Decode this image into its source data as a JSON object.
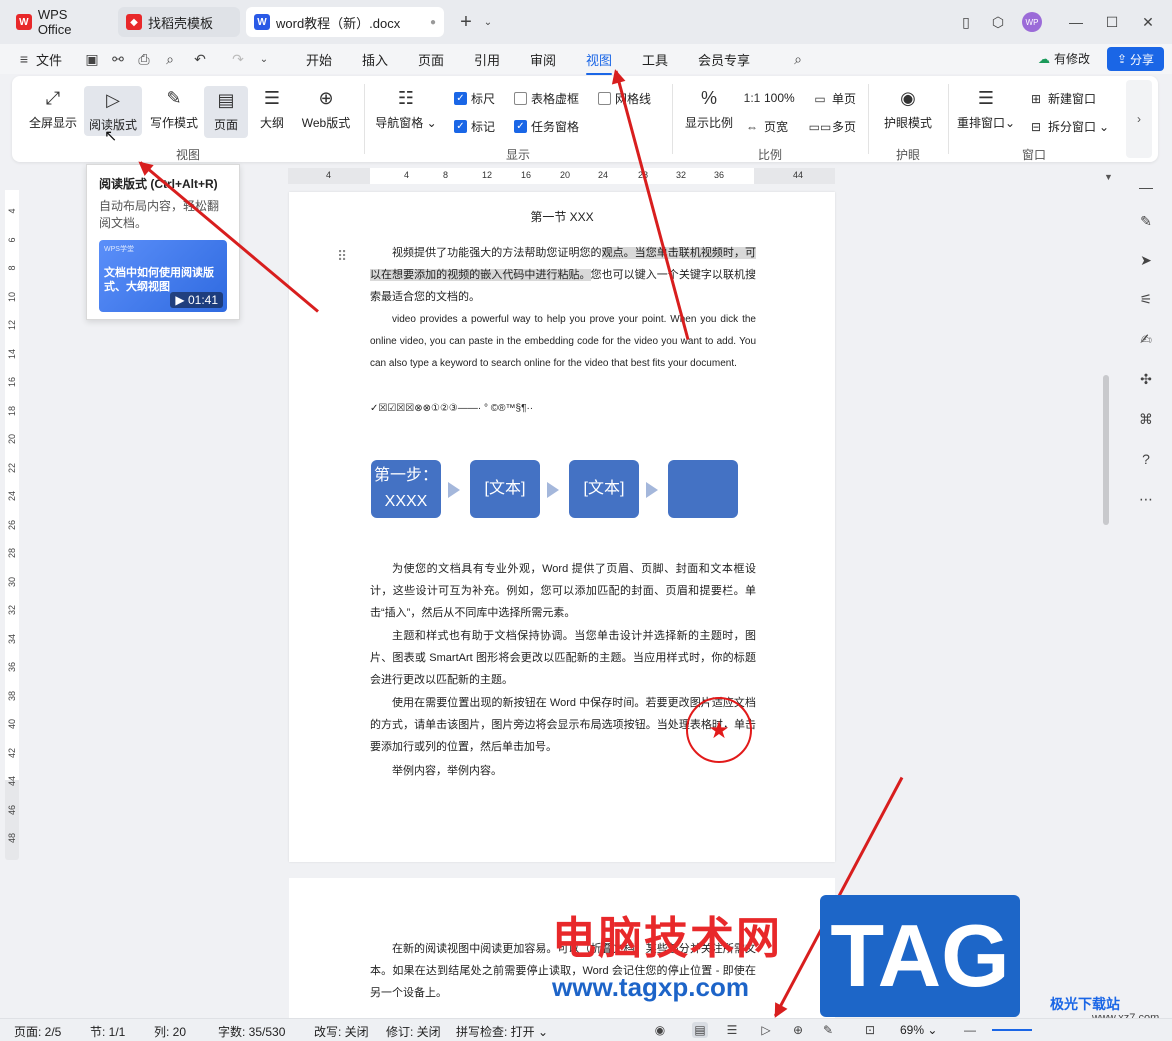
{
  "tabs": [
    {
      "label": "WPS Office",
      "icon": "wps-logo-icon",
      "color": "#e8282a"
    },
    {
      "label": "找稻壳模板",
      "icon": "daoke-logo-icon",
      "color": "#e8282a"
    },
    {
      "label": "word教程（新）.docx",
      "icon": "word-doc-icon",
      "color": "#2a5ae6"
    }
  ],
  "avatar": "WP",
  "menu": {
    "file": "文件",
    "items": [
      "开始",
      "插入",
      "页面",
      "引用",
      "审阅",
      "视图",
      "工具",
      "会员专享"
    ],
    "active": "视图",
    "edit_status": "有修改",
    "share": "分享"
  },
  "ribbon": {
    "view_buttons": [
      "全屏显示",
      "阅读版式",
      "写作模式",
      "页面",
      "大纲",
      "Web版式"
    ],
    "view_group": "视图",
    "nav_pane": "导航窗格",
    "checks": [
      {
        "label": "标尺",
        "on": true
      },
      {
        "label": "表格虚框",
        "on": false
      },
      {
        "label": "网格线",
        "on": false
      },
      {
        "label": "标记",
        "on": true
      },
      {
        "label": "任务窗格",
        "on": true
      }
    ],
    "show_group": "显示",
    "zoom_ratio": "显示比例",
    "zoom_100": "100%",
    "page_width": "页宽",
    "single_page": "单页",
    "multi_page": "多页",
    "zoom_group": "比例",
    "eye_mode": "护眼模式",
    "eye_group": "护眼",
    "rearrange": "重排窗口",
    "new_window": "新建窗口",
    "split_window": "拆分窗口",
    "window_group": "窗口"
  },
  "tooltip": {
    "title": "阅读版式 (Ctrl+Alt+R)",
    "desc": "自动布局内容，轻松翻阅文档。",
    "video_brand": "WPS学堂",
    "video_title": "文档中如何使用阅读版式、大纲视图",
    "duration": "01:41"
  },
  "hruler": [
    "4",
    "4",
    "8",
    "12",
    "16",
    "20",
    "24",
    "28",
    "32",
    "36",
    "44"
  ],
  "vruler": [
    "4",
    "6",
    "8",
    "10",
    "12",
    "14",
    "16",
    "18",
    "20",
    "22",
    "24",
    "26",
    "28",
    "30",
    "32",
    "34",
    "36",
    "38",
    "40",
    "42",
    "44",
    "46",
    "48"
  ],
  "doc": {
    "heading": "第一节 XXX",
    "p1": [
      "视频提供了功能强大的方法帮助您证明您的",
      "观点。当您单击联机视频时，可以在想要添加的视频的嵌入代码中进行粘贴。",
      "您也可以键入一个关键字以联机搜索最适合您的文档的。"
    ],
    "p2": "video provides a powerful way to help you prove your point. When you dick the online video, you can paste in the embedding code for the video you want to add. You can also type a keyword to search online for the video that best fits your document.",
    "symbols": "✓☒☑☒☒⊗⊗①②③——·     °   ©®™§¶··",
    "smartart": [
      "第一步：XXXX",
      "[文本]",
      "[文本]",
      ""
    ],
    "p3": "为使您的文档具有专业外观，Word 提供了页眉、页脚、封面和文本框设计，这些设计可互为补充。例如，您可以添加匹配的封面、页眉和提要栏。单击“插入”，然后从不同库中选择所需元素。",
    "p4": "主题和样式也有助于文档保持协调。当您单击设计并选择新的主题时，图片、图表或 SmartArt 图形将会更改以匹配新的主题。当应用样式时，你的标题会进行更改以匹配新的主题。",
    "p5": "使用在需要位置出现的新按钮在 Word 中保存时间。若要更改图片适应文档的方式，请单击该图片，图片旁边将会显示布局选项按钮。当处理表格时，单击要添加行或列的位置，然后单击加号。",
    "p6": "举例内容，举例内容。",
    "p7": "在新的阅读视图中阅读更加容易。可以（折叠文档）某些部分并关注所需文本。如果在达到结尾处之前需要停止读取，Word 会记住您的停止位置 - 即使在另一个设备上。"
  },
  "status": {
    "page": "页面: 2/5",
    "section": "节: 1/1",
    "col": "列: 20",
    "words": "字数: 35/530",
    "rev_mode": "改写: 关闭",
    "track": "修订: 关闭",
    "spell": "拼写检查: 打开",
    "zoom": "69%"
  },
  "watermark": {
    "cn": "电脑技术网",
    "url": "www.tagxp.com",
    "tag": "TAG",
    "site": "极光下载站",
    "site_url": "www.xz7.com"
  }
}
